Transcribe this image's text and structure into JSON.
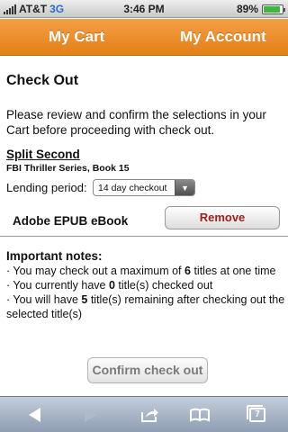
{
  "status": {
    "carrier": "AT&T",
    "network": "3G",
    "time": "3:46 PM",
    "battery": "89%",
    "battery_level": 0.89
  },
  "nav": {
    "cart": "My Cart",
    "account": "My Account"
  },
  "page": {
    "title": "Check Out",
    "intro": "Please review and confirm the selections in your Cart before proceeding with check out."
  },
  "item": {
    "title": "Split Second",
    "series": "FBI Thriller Series, Book 15",
    "lending_label": "Lending period:",
    "lending_value": "14 day checkout",
    "format": "Adobe EPUB eBook",
    "remove_label": "Remove"
  },
  "notes": {
    "title": "Important notes:",
    "line1_pre": "· You may check out a maximum of ",
    "line1_num": "6",
    "line1_post": " titles at one time",
    "line2_pre": "· You currently have ",
    "line2_num": "0",
    "line2_post": " title(s) checked out",
    "line3_pre": "· You will have ",
    "line3_num": "5",
    "line3_post": " title(s) remaining after checking out the selected title(s)"
  },
  "confirm_label": "Confirm check out",
  "toolbar": {
    "back_icon": "back-arrow-icon",
    "forward_icon": "forward-arrow-icon",
    "share_icon": "share-icon",
    "bookmarks_icon": "bookmarks-icon",
    "pages_icon": "pages-icon",
    "pages_count": "7"
  },
  "colors": {
    "nav_orange": "#e8861f",
    "remove_text": "#9b2020",
    "toolbar_blue": "#a4b2c6"
  }
}
